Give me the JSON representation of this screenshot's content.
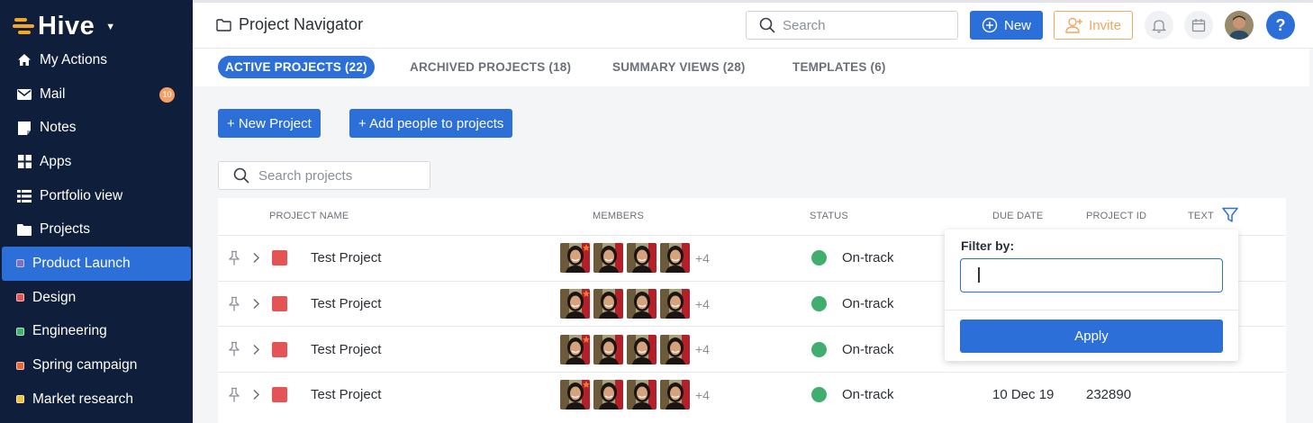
{
  "app": {
    "name": "Hive"
  },
  "sidebar": {
    "items": [
      {
        "label": "My Actions",
        "icon": "home-icon"
      },
      {
        "label": "Mail",
        "icon": "mail-icon",
        "badge": "10"
      },
      {
        "label": "Notes",
        "icon": "notes-icon"
      },
      {
        "label": "Apps",
        "icon": "apps-icon"
      },
      {
        "label": "Portfolio view",
        "icon": "list-icon"
      },
      {
        "label": "Projects",
        "icon": "folder-icon"
      },
      {
        "label": "Product Launch",
        "color": "#7b6fd6"
      },
      {
        "label": "Design",
        "color": "#e45454"
      },
      {
        "label": "Engineering",
        "color": "#3fae6e"
      },
      {
        "label": "Spring campaign",
        "color": "#e8663c"
      },
      {
        "label": "Market research",
        "color": "#f0c040"
      }
    ]
  },
  "header": {
    "title": "Project Navigator",
    "search_placeholder": "Search",
    "new_label": "New",
    "invite_label": "Invite",
    "help_label": "?"
  },
  "tabs": [
    {
      "label": "ACTIVE PROJECTS (22)",
      "active": true
    },
    {
      "label": "ARCHIVED PROJECTS (18)"
    },
    {
      "label": "SUMMARY VIEWS (28)"
    },
    {
      "label": "TEMPLATES (6)"
    }
  ],
  "actions": {
    "new_project": "+ New Project",
    "add_people": "+ Add people to projects",
    "search_placeholder": "Search projects"
  },
  "table": {
    "columns": [
      "PROJECT NAME",
      "MEMBERS",
      "STATUS",
      "DUE DATE",
      "PROJECT ID",
      "TEXT"
    ],
    "rows": [
      {
        "name": "Test Project",
        "extra_members": "+4",
        "status": "On-track",
        "due": "",
        "id": ""
      },
      {
        "name": "Test Project",
        "extra_members": "+4",
        "status": "On-track",
        "due": "",
        "id": ""
      },
      {
        "name": "Test Project",
        "extra_members": "+4",
        "status": "On-track",
        "due": "",
        "id": ""
      },
      {
        "name": "Test Project",
        "extra_members": "+4",
        "status": "On-track",
        "due": "10 Dec 19",
        "id": "232890"
      }
    ]
  },
  "filter_popup": {
    "label": "Filter by:",
    "value": "",
    "apply_label": "Apply"
  },
  "colors": {
    "accent": "#2d6fd8",
    "sidebar_bg": "#0f1e3a",
    "invite": "#f1a75f",
    "status_on_track": "#3fae6e",
    "project_color": "#e45454"
  }
}
